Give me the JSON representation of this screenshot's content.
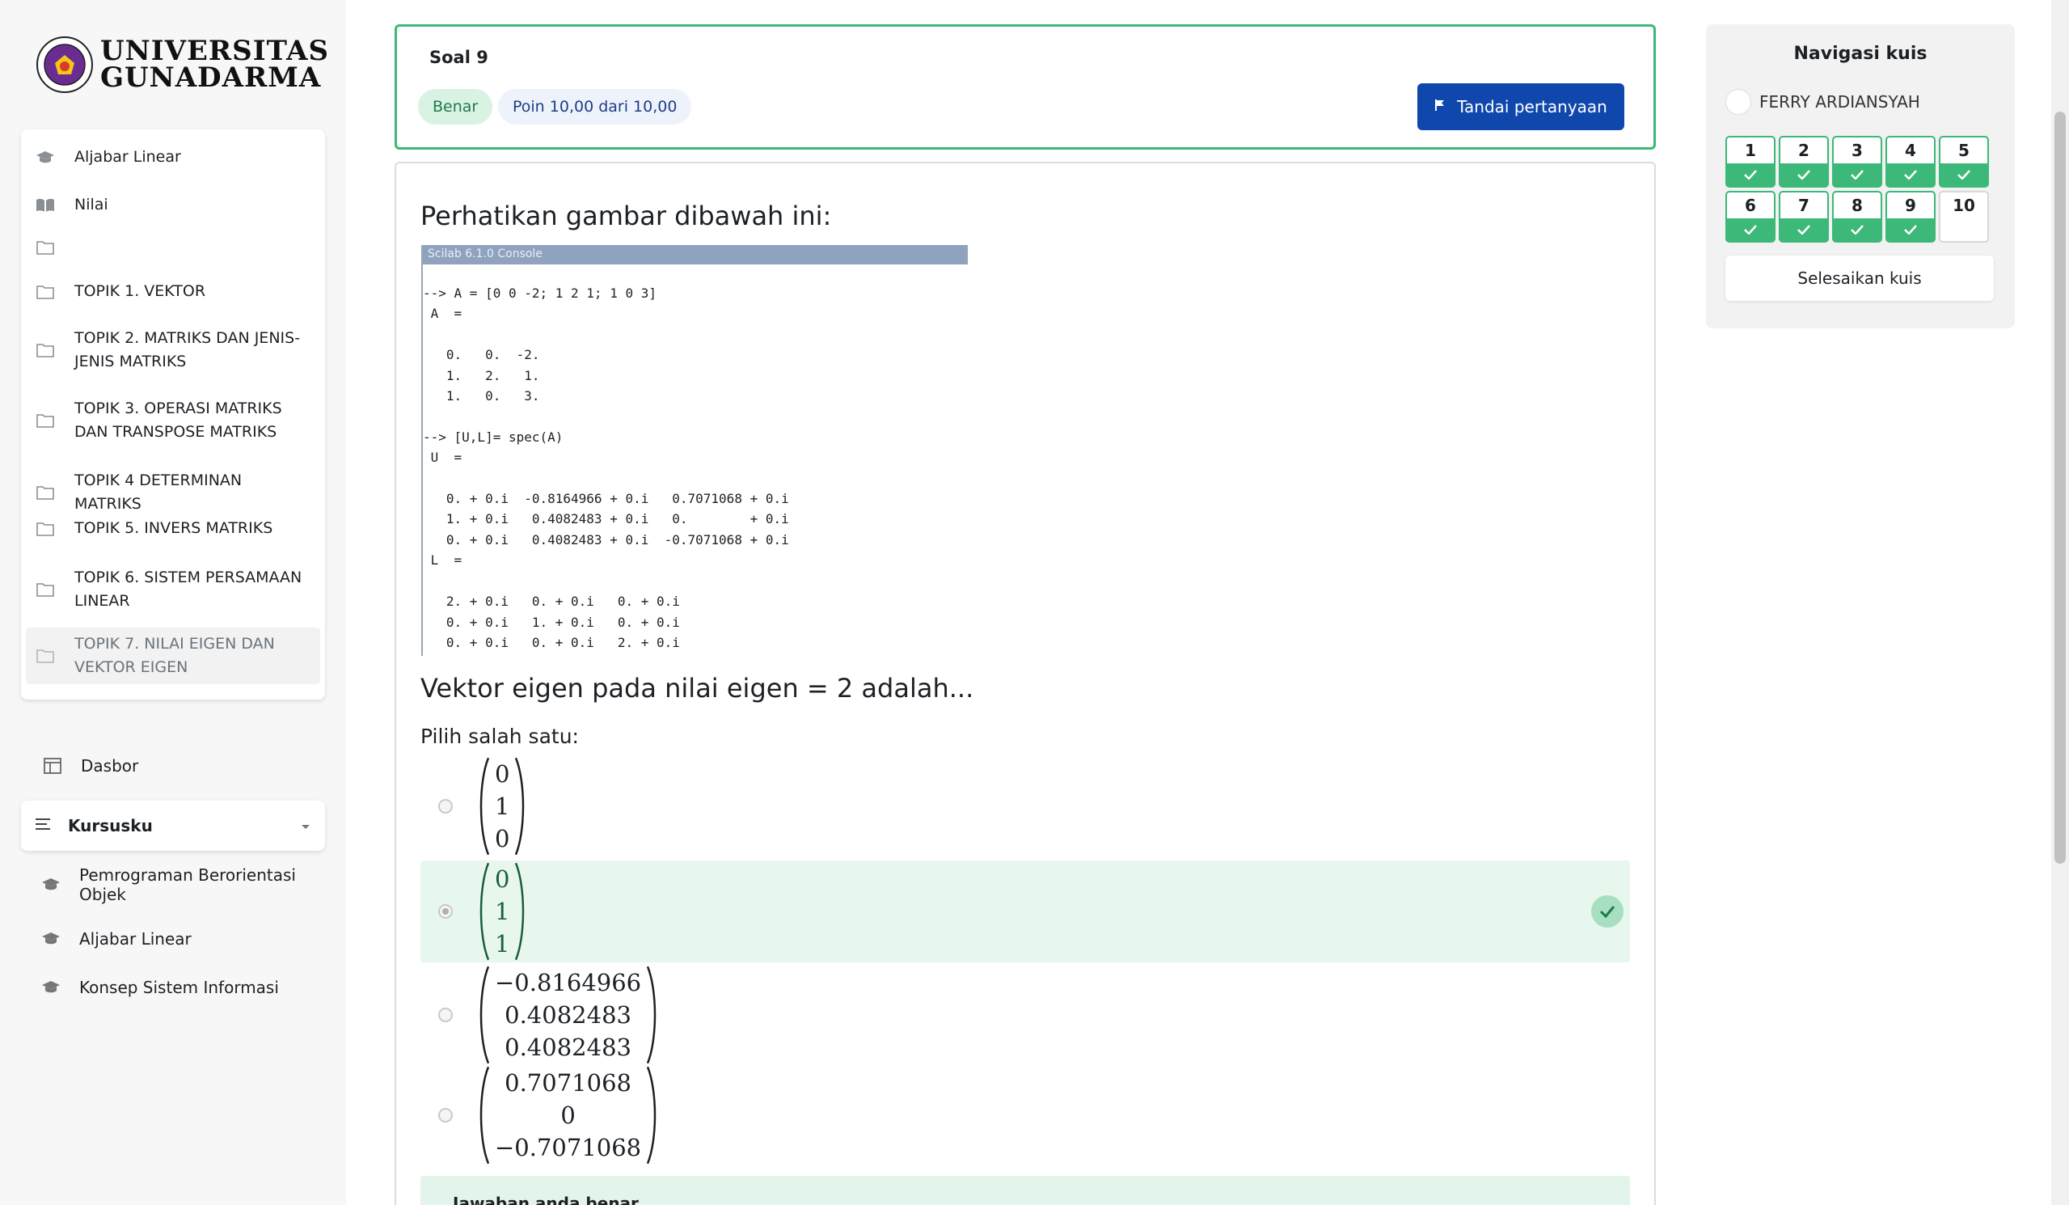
{
  "logo": {
    "line1": "UNIVERSITAS",
    "line2": "GUNADARMA"
  },
  "course_nav": [
    {
      "label": "Aljabar Linear",
      "icon": "graduation-cap-icon"
    },
    {
      "label": "Nilai",
      "icon": "book-icon"
    },
    {
      "label": "",
      "icon": "folder-icon"
    },
    {
      "label": "TOPIK 1. VEKTOR",
      "icon": "folder-icon"
    },
    {
      "label": "TOPIK 2. MATRIKS DAN JENIS-JENIS MATRIKS",
      "icon": "folder-icon"
    },
    {
      "label": "TOPIK 3. OPERASI MATRIKS DAN TRANSPOSE MATRIKS",
      "icon": "folder-icon"
    },
    {
      "label": "TOPIK 4 DETERMINAN MATRIKS",
      "icon": "folder-icon"
    },
    {
      "label": "TOPIK 5. INVERS MATRIKS",
      "icon": "folder-icon"
    },
    {
      "label": "TOPIK 6. SISTEM PERSAMAAN LINEAR",
      "icon": "folder-icon"
    },
    {
      "label": "TOPIK 7. NILAI EIGEN DAN VEKTOR EIGEN",
      "icon": "folder-icon",
      "active": true
    }
  ],
  "dasbor": "Dasbor",
  "kursusku": {
    "label": "Kursusku",
    "items": [
      "Pemrograman Berorientasi Objek",
      "Aljabar Linear",
      "Konsep Sistem Informasi"
    ]
  },
  "question": {
    "title": "Soal 9",
    "state": "Benar",
    "grade": "Poin 10,00 dari 10,00",
    "flag_label": "Tandai pertanyaan",
    "prompt": "Perhatikan gambar dibawah ini:",
    "console_title": "Scilab 6.1.0 Console",
    "console_text": "--> A = [0 0 -2; 1 2 1; 1 0 3]\n A  =\n\n   0.   0.  -2.\n   1.   2.   1.\n   1.   0.   3.\n\n--> [U,L]= spec(A)\n U  =\n\n   0. + 0.i  -0.8164966 + 0.i   0.7071068 + 0.i\n   1. + 0.i   0.4082483 + 0.i   0.        + 0.i\n   0. + 0.i   0.4082483 + 0.i  -0.7071068 + 0.i\n L  =\n\n   2. + 0.i   0. + 0.i   0. + 0.i\n   0. + 0.i   1. + 0.i   0. + 0.i\n   0. + 0.i   0. + 0.i   2. + 0.i",
    "text": "Vektor eigen pada nilai eigen = 2 adalah...",
    "choose": "Pilih salah satu:",
    "options": [
      {
        "values": [
          "0",
          "1",
          "0"
        ],
        "selected": false,
        "correct": false
      },
      {
        "values": [
          "0",
          "1",
          "1"
        ],
        "selected": true,
        "correct": true
      },
      {
        "values": [
          "−0.8164966",
          "0.4082483",
          "0.4082483"
        ],
        "selected": false,
        "correct": false
      },
      {
        "values": [
          "0.7071068",
          "0",
          "−0.7071068"
        ],
        "selected": false,
        "correct": false
      }
    ],
    "feedback": "Jawaban anda benar."
  },
  "quiz_nav": {
    "title": "Navigasi kuis",
    "user": "FERRY ARDIANSYAH",
    "buttons": [
      {
        "n": "1",
        "done": true
      },
      {
        "n": "2",
        "done": true
      },
      {
        "n": "3",
        "done": true
      },
      {
        "n": "4",
        "done": true
      },
      {
        "n": "5",
        "done": true
      },
      {
        "n": "6",
        "done": true
      },
      {
        "n": "7",
        "done": true
      },
      {
        "n": "8",
        "done": true
      },
      {
        "n": "9",
        "done": true
      },
      {
        "n": "10",
        "done": false
      }
    ],
    "finish": "Selesaikan kuis"
  },
  "colors": {
    "accent": "#0f47ad",
    "success": "#3cb878",
    "success_bg": "#e7f7ee"
  }
}
